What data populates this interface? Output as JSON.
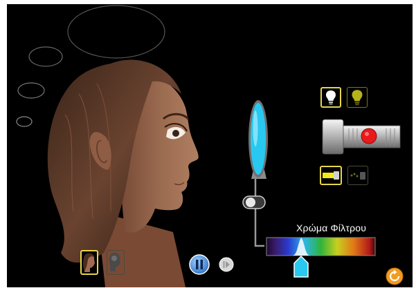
{
  "simulation": {
    "filter_label": "Χρώμα Φίλτρου",
    "filter_position": 0.32,
    "playing": true,
    "light_mode": "white",
    "beam_mode": "solid",
    "view_mode": "face"
  },
  "controls": {
    "white_light_icon": "white-bulb-icon",
    "colored_light_icon": "yellow-bulb-icon",
    "solid_beam_icon": "solid-beam-icon",
    "photon_beam_icon": "photon-beam-icon",
    "face_view_icon": "face-view-icon",
    "brain_view_icon": "brain-view-icon",
    "pause_icon": "pause-icon",
    "step_icon": "step-icon",
    "reset_icon": "reset-icon"
  },
  "colors": {
    "background": "#000000",
    "selection": "#e7d64a",
    "filter": "#29c8f0",
    "flashlight_button": "#e81a1a",
    "pause_button": "#3e8ed6",
    "reset_button": "#f39b1e"
  }
}
